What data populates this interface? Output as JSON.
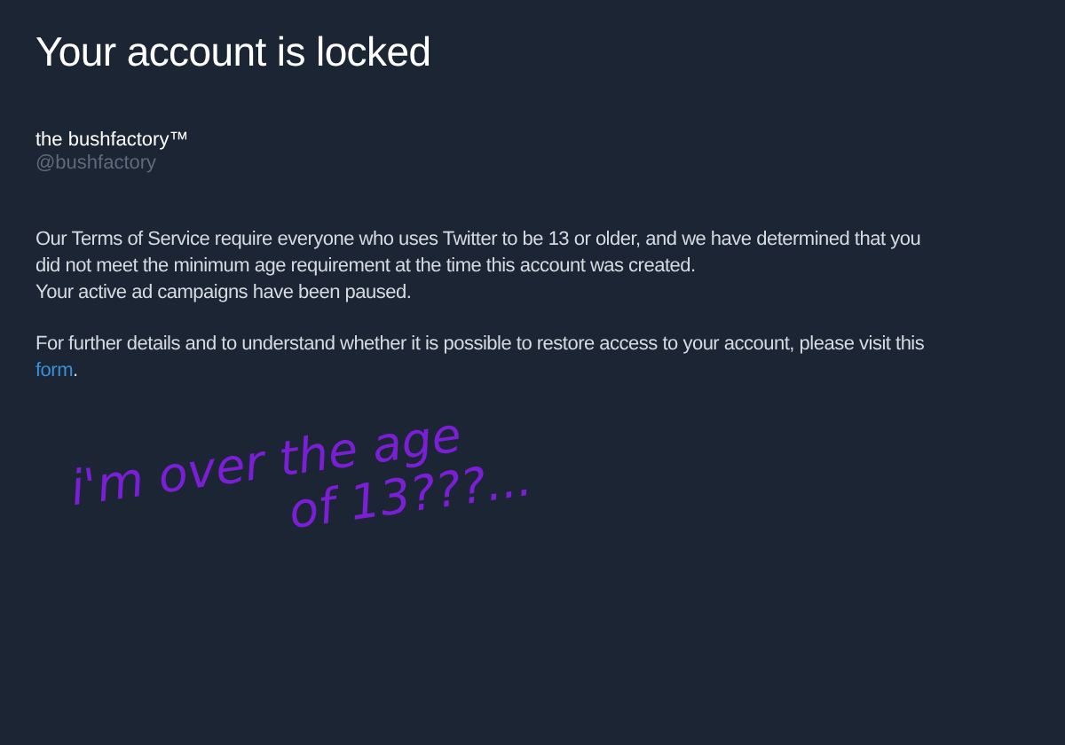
{
  "title": "Your account is locked",
  "account": {
    "name": "the bushfactory™",
    "handle": "@bushfactory"
  },
  "paragraphs": [
    {
      "lines": [
        "Our Terms of Service require everyone who uses Twitter to be 13 or older, and we have determined that you did not meet the minimum age requirement at the time this account was created.",
        "Your active ad campaigns have been paused."
      ]
    },
    {
      "lines": [
        "For further details and to understand whether it is possible to restore access to your account, please visit this"
      ],
      "link": "form",
      "after": "."
    }
  ],
  "annotation": {
    "lines": [
      "i'm over the age",
      "of 13???..."
    ],
    "color": "#7a1fd6"
  }
}
